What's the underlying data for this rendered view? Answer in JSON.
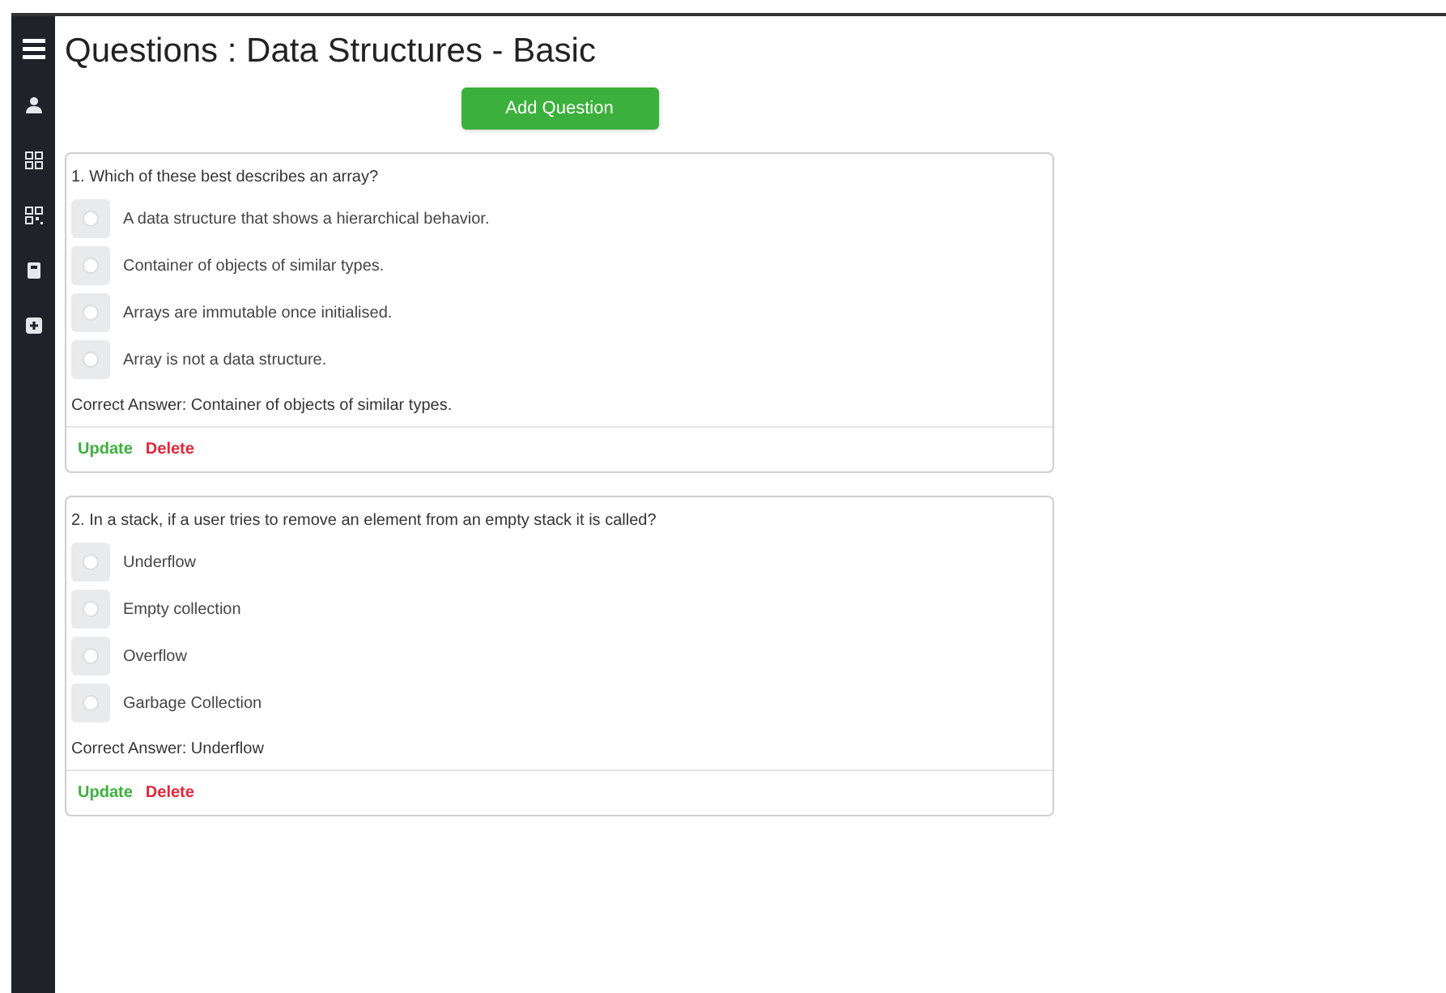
{
  "page_title": "Questions : Data Structures - Basic",
  "add_button": "Add Question",
  "questions": [
    {
      "text": "1. Which of these best describes an array?",
      "options": [
        {
          "label": "A data structure that shows a hierarchical behavior.",
          "selected": false
        },
        {
          "label": "Container of objects of similar types.",
          "selected": false
        },
        {
          "label": "Arrays are immutable once initialised.",
          "selected": false
        },
        {
          "label": "Array is not a data structure.",
          "selected": false
        }
      ],
      "correct_answer": "Correct Answer: Container of objects of similar types.",
      "actions": [
        "Update",
        "Delete"
      ]
    },
    {
      "text": "2. In a stack, if a user tries to remove an element from an empty stack it is called?",
      "options": [
        {
          "label": "Underflow",
          "selected": false
        },
        {
          "label": "Empty collection",
          "selected": false
        },
        {
          "label": "Overflow",
          "selected": false
        },
        {
          "label": "Garbage Collection",
          "selected": false
        }
      ],
      "correct_answer": "Correct Answer: Underflow",
      "actions": [
        "Update",
        "Delete"
      ]
    }
  ]
}
